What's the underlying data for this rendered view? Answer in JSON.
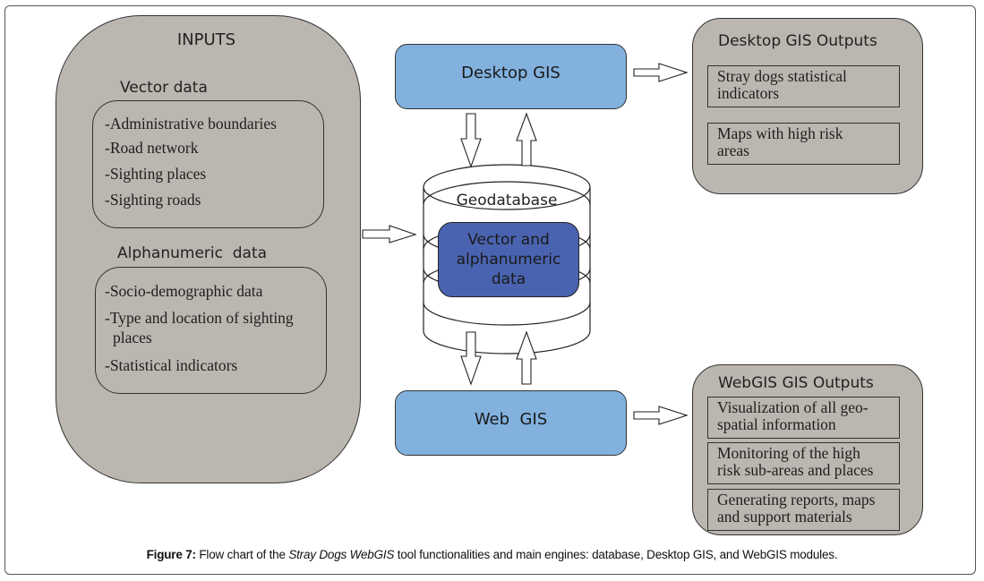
{
  "inputs": {
    "title": "INPUTS",
    "vector": {
      "heading": "Vector data",
      "items": [
        "-Administrative boundaries",
        "-Road network",
        "-Sighting places",
        "-Sighting roads"
      ]
    },
    "alphanumeric": {
      "heading": "Alphanumeric  data",
      "items": [
        "-Socio-demographic data",
        "-Type and location of sighting",
        "places",
        "-Statistical indicators"
      ]
    }
  },
  "engines": {
    "desktop_gis": "Desktop GIS",
    "web_gis": "Web  GIS",
    "geodatabase": {
      "label": "Geodatabase",
      "core_lines": [
        "Vector and",
        "alphanumeric",
        "data"
      ]
    }
  },
  "desktop_outputs": {
    "title": "Desktop GIS Outputs",
    "items": [
      [
        "Stray dogs statistical",
        "indicators"
      ],
      [
        "Maps with high risk",
        "areas"
      ]
    ]
  },
  "web_outputs": {
    "title": "WebGIS GIS Outputs",
    "items": [
      [
        "Visualization of all geo-",
        "spatial information"
      ],
      [
        "Monitoring of the high",
        "risk sub-areas and places"
      ],
      [
        "Generating reports, maps",
        "and support materials"
      ]
    ]
  },
  "caption": {
    "label": "Figure 7:",
    "pre": " Flow chart of the ",
    "italic": "Stray Dogs WebGIS",
    "post": " tool functionalities and main engines: database, Desktop GIS, and WebGIS modules."
  },
  "colors": {
    "panel_grey": "#bcb6b0",
    "engine_blue": "#82b1de",
    "database_core": "#4a63b0"
  }
}
